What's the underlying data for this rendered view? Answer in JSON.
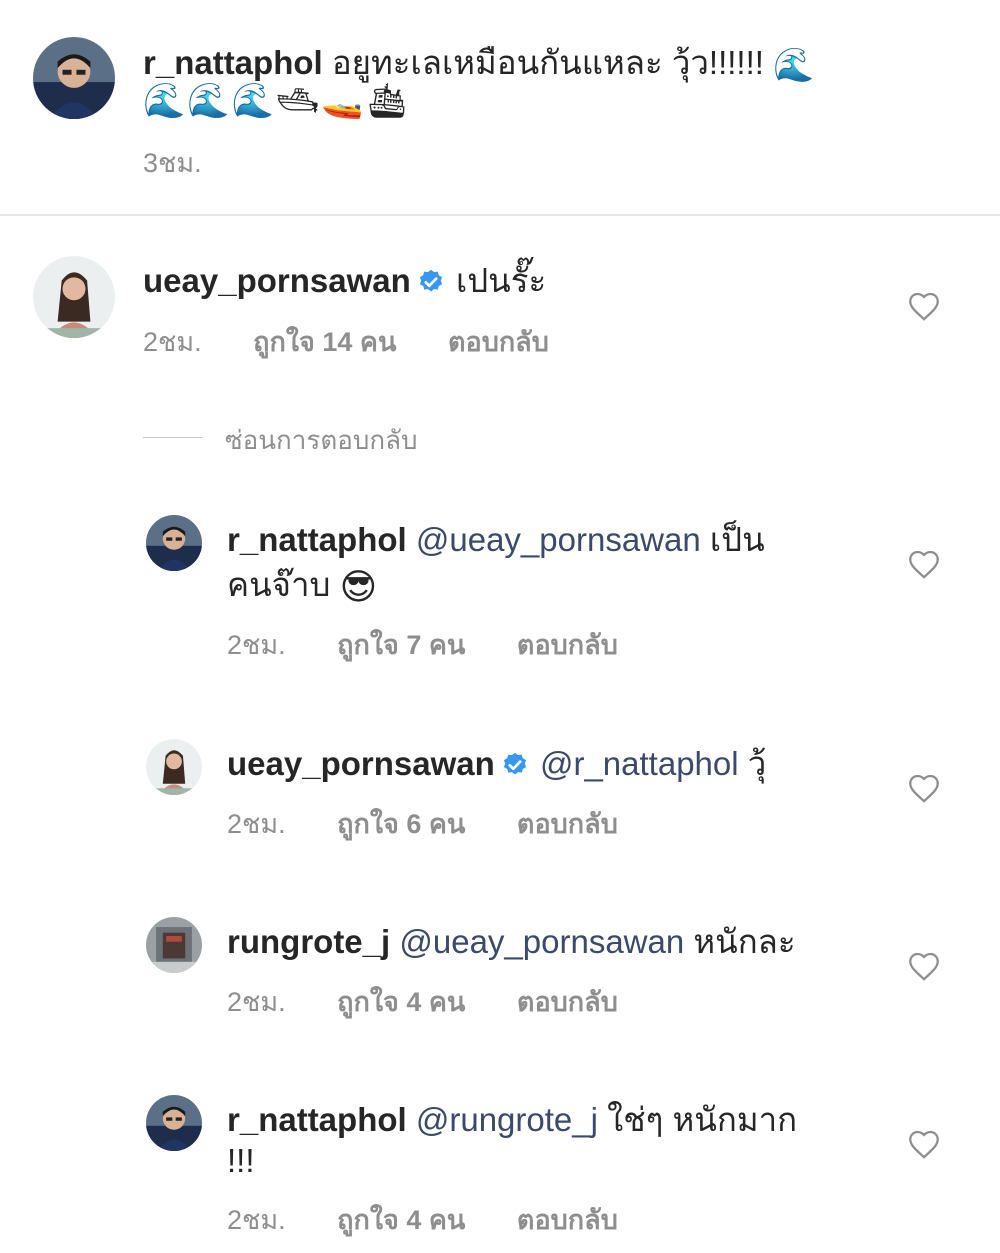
{
  "caption": {
    "username": "r_nattaphol",
    "text": "อยูทะเลเหมือนกันแหละ วุ้ว!!!!!!",
    "emoji_line": "🌊🌊🌊🛥🚤🛳",
    "first_emoji": "🌊",
    "time": "3ชม."
  },
  "comments": [
    {
      "username": "ueay_pornsawan",
      "verified": true,
      "text": "เปนรั๊ะ",
      "time": "2ชม.",
      "likes": "ถูกใจ 14 คน",
      "reply_label": "ตอบกลับ"
    }
  ],
  "hide_replies_label": "ซ่อนการตอบกลับ",
  "replies": [
    {
      "username": "r_nattaphol",
      "mention": "@ueay_pornsawan",
      "text": "เป็น",
      "text2": "คนจ๊าบ",
      "emoji": "😎",
      "time": "2ชม.",
      "likes": "ถูกใจ 7 คน",
      "reply_label": "ตอบกลับ"
    },
    {
      "username": "ueay_pornsawan",
      "verified": true,
      "mention": "@r_nattaphol",
      "text": "วุ้",
      "time": "2ชม.",
      "likes": "ถูกใจ 6 คน",
      "reply_label": "ตอบกลับ"
    },
    {
      "username": "rungrote_j",
      "mention": "@ueay_pornsawan",
      "text": "หนักละ",
      "time": "2ชม.",
      "likes": "ถูกใจ 4 คน",
      "reply_label": "ตอบกลับ"
    },
    {
      "username": "r_nattaphol",
      "mention": "@rungrote_j",
      "text": "ใช่ๆ หนักมาก",
      "text2": "!!!",
      "time": "2ชม.",
      "likes": "ถูกใจ 4 คน",
      "reply_label": "ตอบกลับ"
    }
  ],
  "icons": {
    "heart": "heart-outline-icon",
    "verified": "verified-badge-icon"
  },
  "colors": {
    "text": "#262626",
    "meta": "#8e8e8e",
    "verified": "#3897f0",
    "mention": "#3b4a6b"
  }
}
